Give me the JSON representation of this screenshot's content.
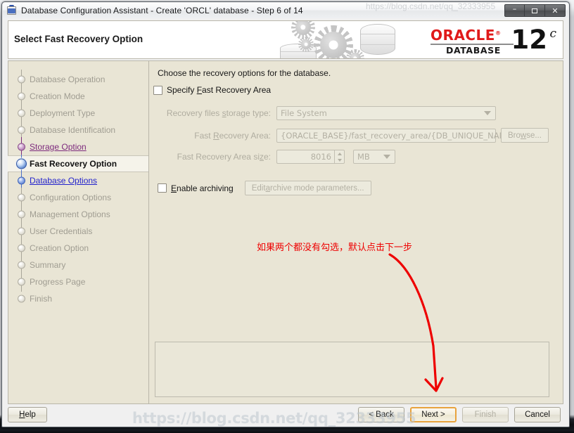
{
  "window": {
    "title": "Database Configuration Assistant - Create 'ORCL' database - Step 6 of 14",
    "icon": "java-coffee-cup-icon",
    "minimize_label": "–",
    "maximize_label": "",
    "close_label": "✕"
  },
  "banner": {
    "title": "Select Fast Recovery Option",
    "logo": {
      "brand": "ORACLE",
      "registered": "®",
      "product": "DATABASE",
      "version_number": "12",
      "version_suffix": "c"
    }
  },
  "sidebar": {
    "items": [
      {
        "label": "Database Operation",
        "state": "pending"
      },
      {
        "label": "Creation Mode",
        "state": "pending"
      },
      {
        "label": "Deployment Type",
        "state": "pending"
      },
      {
        "label": "Database Identification",
        "state": "pending"
      },
      {
        "label": "Storage Option",
        "state": "visited"
      },
      {
        "label": "Fast Recovery Option",
        "state": "current"
      },
      {
        "label": "Database Options",
        "state": "link"
      },
      {
        "label": "Configuration Options",
        "state": "pending"
      },
      {
        "label": "Management Options",
        "state": "pending"
      },
      {
        "label": "User Credentials",
        "state": "pending"
      },
      {
        "label": "Creation Option",
        "state": "pending"
      },
      {
        "label": "Summary",
        "state": "pending"
      },
      {
        "label": "Progress Page",
        "state": "pending"
      },
      {
        "label": "Finish",
        "state": "pending"
      }
    ]
  },
  "content": {
    "instruction": "Choose the recovery options for the database.",
    "specify_fra": {
      "label_pre": "Specify ",
      "label_mnemonic": "F",
      "label_post": "ast Recovery Area",
      "checked": false
    },
    "storage_type": {
      "label_pre": "Recovery files ",
      "label_mnemonic": "s",
      "label_post": "torage type:",
      "value": "File System",
      "enabled": false
    },
    "fra_path": {
      "label_pre": "Fast ",
      "label_mnemonic": "R",
      "label_post": "ecovery Area:",
      "value": "{ORACLE_BASE}/fast_recovery_area/{DB_UNIQUE_NAME}",
      "enabled": false
    },
    "browse_button": {
      "label_pre": "Bro",
      "label_mnemonic": "w",
      "label_post": "se...",
      "enabled": false
    },
    "fra_size": {
      "label_pre": "Fast Recovery Area si",
      "label_mnemonic": "z",
      "label_post": "e:",
      "value": "8016",
      "unit": "MB",
      "enabled": false
    },
    "enable_archiving": {
      "label_pre": "",
      "label_mnemonic": "E",
      "label_post": "nable archiving",
      "checked": false
    },
    "edit_archive_button": {
      "label_pre": "Edit ",
      "label_mnemonic": "a",
      "label_post": "rchive mode parameters...",
      "enabled": false
    }
  },
  "annotation": {
    "text": "如果两个都没有勾选，默认点击下一步",
    "color": "#ee0000",
    "arrow": "curved-down-arrow"
  },
  "footer": {
    "help": {
      "pre": "H",
      "mnemonic": "H",
      "post": "elp",
      "label": "Help"
    },
    "back": {
      "label": "< Back",
      "mnemonic": "B",
      "enabled": true
    },
    "next": {
      "label": "Next >",
      "mnemonic": "N",
      "enabled": true,
      "focused": true
    },
    "finish": {
      "label": "Finish",
      "mnemonic": "F",
      "enabled": false
    },
    "cancel": {
      "label": "Cancel",
      "mnemonic": "C",
      "enabled": true
    }
  },
  "watermark": {
    "text": "https://blog.csdn.net/qq_32333955"
  },
  "colors": {
    "panel_bg": "#e9e5d5",
    "banner_bg": "#ffffff",
    "oracle_red": "#e01a1a",
    "link_blue": "#2222cc",
    "visited_purple": "#7d2a7d",
    "focus_orange": "#e8a33d",
    "annotation_red": "#ee0000"
  }
}
